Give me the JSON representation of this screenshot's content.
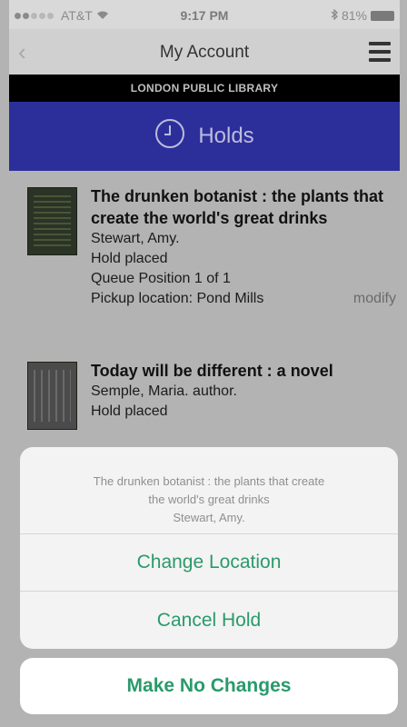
{
  "status_bar": {
    "carrier": "AT&T",
    "time": "9:17 PM",
    "battery": "81%"
  },
  "nav": {
    "back_icon": "chevron-left-icon",
    "title": "My Account",
    "menu_icon": "hamburger-menu-icon"
  },
  "library": {
    "name": "LONDON PUBLIC LIBRARY"
  },
  "section": {
    "icon": "clock-icon",
    "title": "Holds"
  },
  "holds": [
    {
      "title": "The drunken botanist : the plants that create the world's great drinks",
      "author": "Stewart, Amy.",
      "status": "Hold placed",
      "queue": "Queue Position 1 of 1",
      "pickup": "Pickup location: Pond Mills",
      "action": "modify"
    },
    {
      "title": "Today will be different : a novel",
      "author": "Semple, Maria. author.",
      "status": "Hold placed"
    }
  ],
  "action_sheet": {
    "message_line1": "The drunken botanist : the plants that create",
    "message_line2": "the world's great drinks",
    "message_line3": "Stewart, Amy.",
    "change_location": "Change Location",
    "cancel_hold": "Cancel Hold",
    "make_no_changes": "Make No Changes"
  },
  "colors": {
    "holds_bar": "#2c2f9a",
    "action_green": "#2a9a6b"
  }
}
